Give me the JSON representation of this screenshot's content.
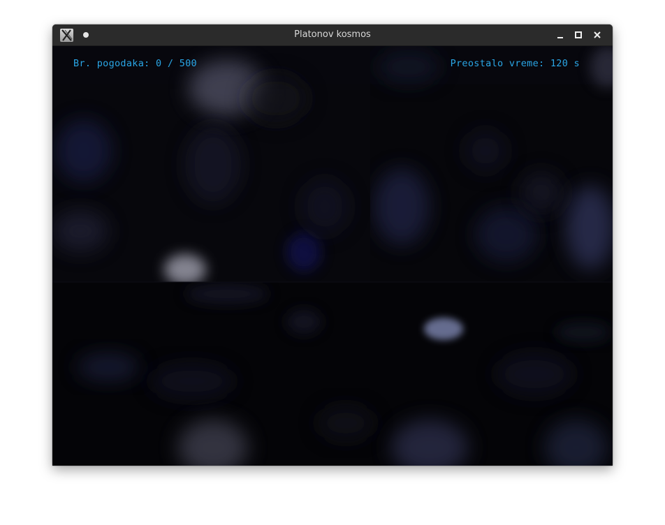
{
  "window": {
    "title": "Platonov kosmos",
    "app_icon": "x-window-icon",
    "buttons": {
      "minimize": "minimize-icon",
      "maximize": "maximize-icon",
      "close": "close-icon"
    }
  },
  "hud": {
    "hits_label": "Br. pogodaka: 0 / 500",
    "time_label": "Preostalo vreme: 120 s"
  },
  "colors": {
    "hud_text": "#2aa6e6",
    "titlebar": "#2b2b2b",
    "background": "#040406"
  }
}
